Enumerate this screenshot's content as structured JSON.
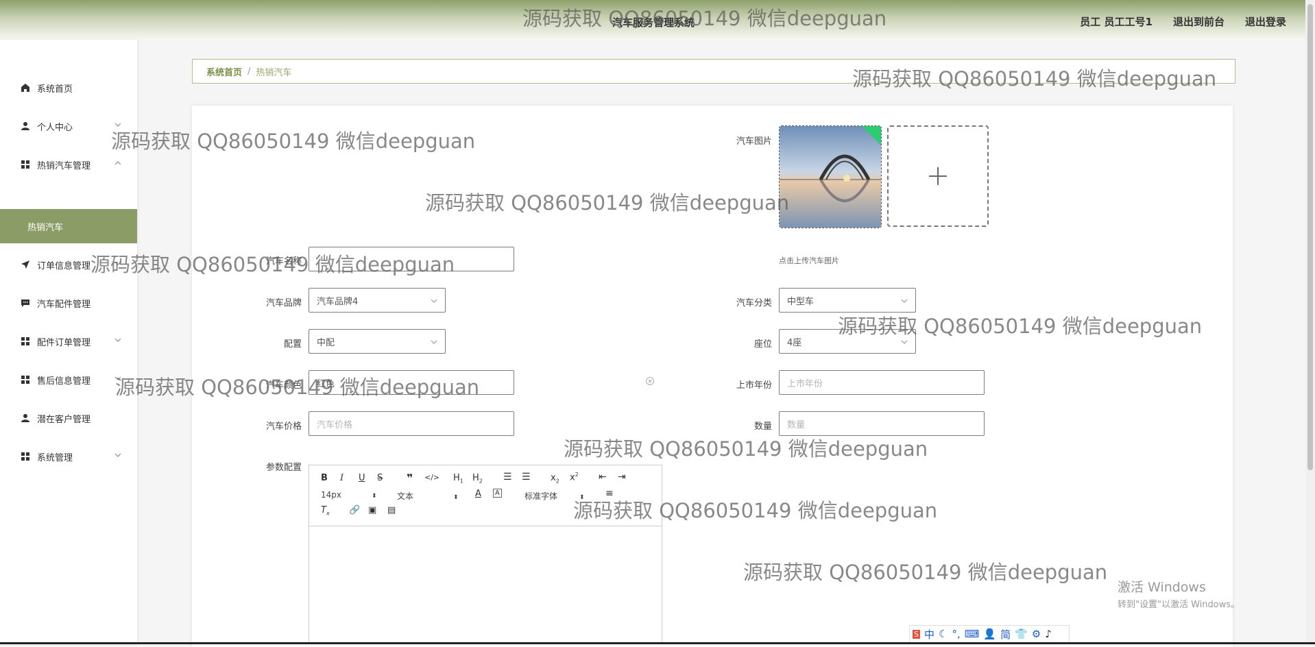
{
  "header": {
    "app_title": "汽车服务管理系统",
    "user_label": "员工 员工工号1",
    "front_link": "退出到前台",
    "logout_link": "退出登录"
  },
  "sidebar": {
    "items": [
      {
        "label": "系统首页",
        "icon": "home-icon"
      },
      {
        "label": "个人中心",
        "icon": "person-icon"
      },
      {
        "label": "热销汽车管理",
        "icon": "grid-icon"
      },
      {
        "label": "订单信息管理",
        "icon": "send-icon"
      },
      {
        "label": "汽车配件管理",
        "icon": "chat-icon"
      },
      {
        "label": "配件订单管理",
        "icon": "grid-icon"
      },
      {
        "label": "售后信息管理",
        "icon": "grid-icon"
      },
      {
        "label": "潜在客户管理",
        "icon": "person-icon"
      },
      {
        "label": "系统管理",
        "icon": "grid-icon"
      }
    ],
    "active_sub": "热销汽车"
  },
  "breadcrumb": {
    "home": "系统首页",
    "separator": "/",
    "current": "热销汽车"
  },
  "form": {
    "car_image_label": "汽车图片",
    "upload_tip": "点击上传汽车图片",
    "name_label": "汽车名称",
    "name_value": "",
    "brand_label": "汽车品牌",
    "brand_value": "汽车品牌4",
    "category_label": "汽车分类",
    "category_value": "中型车",
    "config_label": "配置",
    "config_value": "中配",
    "seats_label": "座位",
    "seats_value": "4座",
    "color_label": "汽车颜色",
    "color_value": "红色",
    "year_label": "上市年份",
    "year_placeholder": "上市年份",
    "price_label": "汽车价格",
    "price_placeholder": "汽车价格",
    "qty_label": "数量",
    "qty_placeholder": "数量",
    "params_label": "参数配置"
  },
  "editor": {
    "font_size": "14px",
    "text_type": "文本",
    "font_family": "标准字体"
  },
  "watermark": "源码获取 QQ86050149 微信deepguan",
  "windows_activation": {
    "line1": "激活 Windows",
    "line2": "转到\"设置\"以激活 Windows。"
  },
  "ime": {
    "mode": "中",
    "simplified": "简"
  },
  "colors": {
    "accent": "#8c9c66",
    "breadcrumb_border": "#b4b98f"
  }
}
